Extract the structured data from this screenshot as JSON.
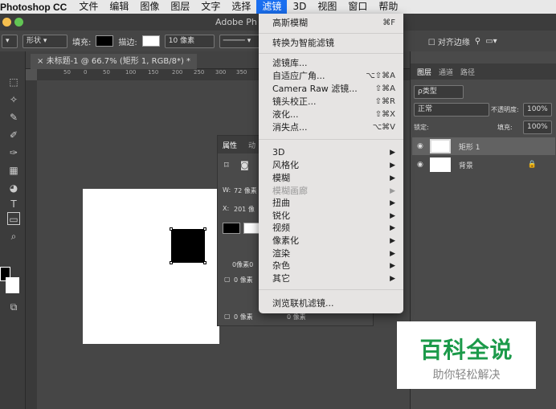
{
  "menubar": {
    "app": "Photoshop CC",
    "items": [
      "文件",
      "编辑",
      "图像",
      "图层",
      "文字",
      "选择",
      "滤镜",
      "3D",
      "视图",
      "窗口",
      "帮助"
    ],
    "active": "滤镜"
  },
  "window": {
    "title": "Adobe Ph"
  },
  "options": {
    "shape_mode": "形状",
    "fill_label": "填充:",
    "stroke_label": "描边:",
    "stroke_width": "10 像素",
    "align_edges": "对齐边缘"
  },
  "document": {
    "tab": "未标题-1 @ 66.7% (矩形 1, RGB/8*) *",
    "ruler": [
      "50",
      "0",
      "50",
      "100",
      "150",
      "200",
      "250",
      "300",
      "350"
    ]
  },
  "properties": {
    "tab1": "属性",
    "tab2": "动",
    "w_label": "W:",
    "w_value": "72 像素",
    "x_label": "X:",
    "x_value": "201 像",
    "corner1": "0像素0",
    "corner2": "0 像素",
    "corner3": "0 像素",
    "corner4": "0 像素"
  },
  "filter_menu": {
    "last_filter": {
      "label": "高斯模糊",
      "shortcut": "⌘F"
    },
    "smart": "转换为智能滤镜",
    "group1": [
      {
        "label": "滤镜库...",
        "shortcut": ""
      },
      {
        "label": "自适应广角...",
        "shortcut": "⌥⇧⌘A"
      },
      {
        "label": "Camera Raw 滤镜...",
        "shortcut": "⇧⌘A"
      },
      {
        "label": "镜头校正...",
        "shortcut": "⇧⌘R"
      },
      {
        "label": "液化...",
        "shortcut": "⇧⌘X"
      },
      {
        "label": "消失点...",
        "shortcut": "⌥⌘V"
      }
    ],
    "group2": [
      {
        "label": "3D",
        "disabled": false
      },
      {
        "label": "风格化",
        "disabled": false
      },
      {
        "label": "模糊",
        "disabled": false
      },
      {
        "label": "模糊画廊",
        "disabled": true
      },
      {
        "label": "扭曲",
        "disabled": false
      },
      {
        "label": "锐化",
        "disabled": false
      },
      {
        "label": "视频",
        "disabled": false
      },
      {
        "label": "像素化",
        "disabled": false
      },
      {
        "label": "渲染",
        "disabled": false
      },
      {
        "label": "杂色",
        "disabled": false
      },
      {
        "label": "其它",
        "disabled": false
      }
    ],
    "browse": "浏览联机滤镜..."
  },
  "layers_panel": {
    "tabs": [
      "图层",
      "通道",
      "路径"
    ],
    "kind": "ρ类型",
    "blend": "正常",
    "opacity_label": "不透明度:",
    "opacity": "100%",
    "lock_label": "锁定:",
    "fill_label": "填充:",
    "fill": "100%",
    "layers": [
      {
        "name": "矩形 1"
      },
      {
        "name": "背景"
      }
    ]
  },
  "watermark": {
    "main": "百科全说",
    "sub": "助你轻松解决"
  }
}
